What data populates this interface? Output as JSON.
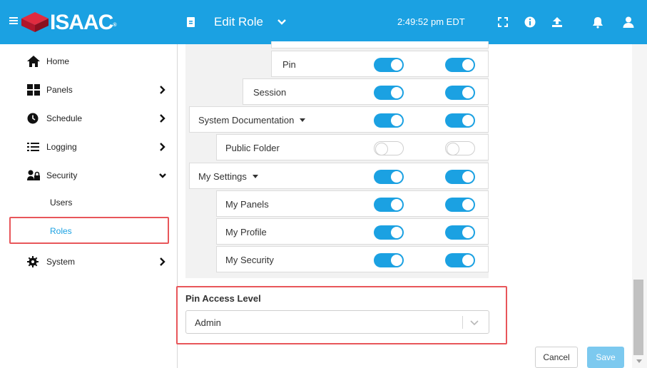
{
  "header": {
    "logo_text": "ISAAC",
    "logo_mark": "®",
    "page_title": "Edit Role",
    "clock": "2:49:52 pm EDT",
    "icons": [
      "hamburger-menu-icon",
      "isaac-logo-icon",
      "document-icon",
      "chevron-down-icon",
      "fullscreen-icon",
      "info-icon",
      "upload-icon",
      "bell-icon",
      "user-icon"
    ]
  },
  "sidebar": {
    "items": [
      {
        "label": "Home",
        "icon": "home-icon"
      },
      {
        "label": "Panels",
        "icon": "panels-icon"
      },
      {
        "label": "Schedule",
        "icon": "clock-icon"
      },
      {
        "label": "Logging",
        "icon": "list-icon"
      },
      {
        "label": "Security",
        "icon": "users-lock-icon"
      },
      {
        "label": "System",
        "icon": "gear-icon"
      }
    ],
    "security_sub": [
      {
        "label": "Users"
      },
      {
        "label": "Roles"
      }
    ]
  },
  "permissions": [
    {
      "label": "Pin",
      "toggle1": true,
      "toggle2": true
    },
    {
      "label": "Session",
      "toggle1": true,
      "toggle2": true
    },
    {
      "label": "System Documentation",
      "toggle1": true,
      "toggle2": true
    },
    {
      "label": "Public Folder",
      "toggle1": false,
      "toggle2": false
    },
    {
      "label": "My Settings",
      "toggle1": true,
      "toggle2": true
    },
    {
      "label": "My Panels",
      "toggle1": true,
      "toggle2": true
    },
    {
      "label": "My Profile",
      "toggle1": true,
      "toggle2": true
    },
    {
      "label": "My Security",
      "toggle1": true,
      "toggle2": true
    }
  ],
  "pin_access": {
    "label": "Pin Access Level",
    "value": "Admin"
  },
  "buttons": {
    "cancel": "Cancel",
    "save": "Save"
  },
  "colors": {
    "accent": "#1ba1e2",
    "highlight": "#e8565a",
    "save_disabled": "#7cc9ef"
  }
}
